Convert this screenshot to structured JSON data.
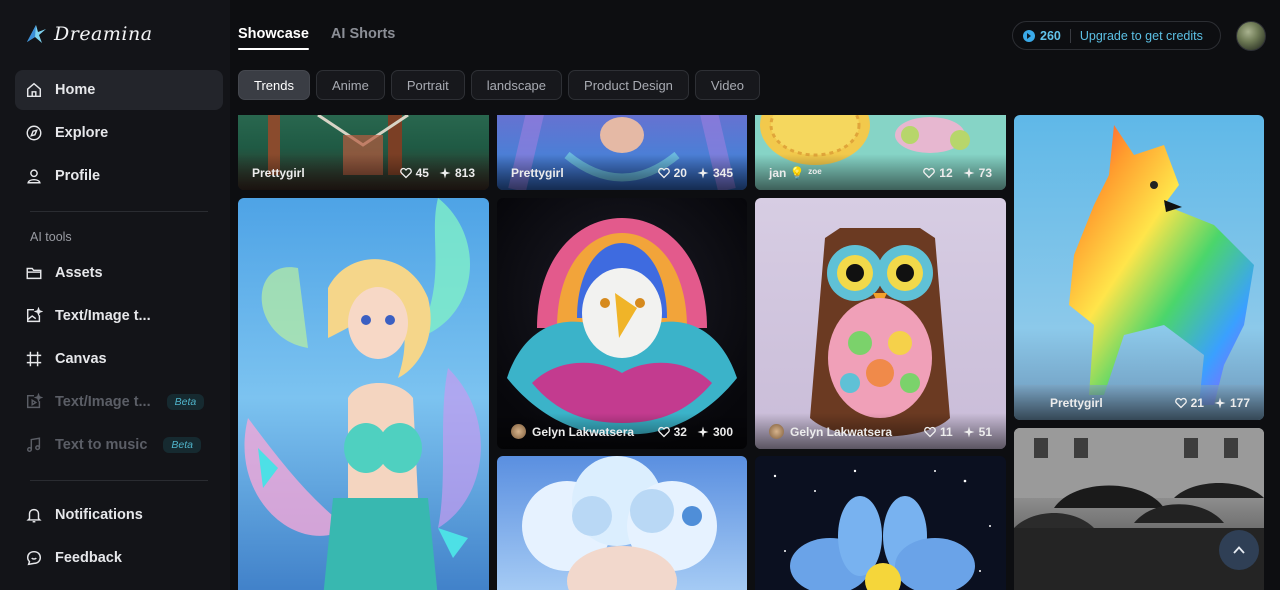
{
  "app": {
    "name": "Dreamina"
  },
  "sidebar": {
    "main_items": [
      {
        "label": "Home",
        "icon": "home-icon"
      },
      {
        "label": "Explore",
        "icon": "compass-icon"
      },
      {
        "label": "Profile",
        "icon": "user-icon"
      }
    ],
    "section_label": "AI tools",
    "tool_items": [
      {
        "label": "Assets",
        "icon": "folder-icon"
      },
      {
        "label": "Text/Image t...",
        "icon": "image-sparkle-icon"
      },
      {
        "label": "Canvas",
        "icon": "canvas-icon"
      },
      {
        "label": "Text/Image t...",
        "icon": "video-icon",
        "badge": "Beta"
      },
      {
        "label": "Text to music",
        "icon": "music-icon",
        "badge": "Beta"
      }
    ],
    "bottom_items": [
      {
        "label": "Notifications",
        "icon": "bell-icon"
      },
      {
        "label": "Feedback",
        "icon": "feedback-icon"
      }
    ]
  },
  "header": {
    "tabs": [
      {
        "label": "Showcase"
      },
      {
        "label": "AI Shorts"
      }
    ],
    "credits": {
      "amount": "260",
      "upgrade_label": "Upgrade to get credits"
    }
  },
  "filters": [
    {
      "label": "Trends"
    },
    {
      "label": "Anime"
    },
    {
      "label": "Portrait"
    },
    {
      "label": "landscape"
    },
    {
      "label": "Product Design"
    },
    {
      "label": "Video"
    }
  ],
  "cards": [
    {
      "author": "Prettygirl",
      "likes": "45",
      "uses": "813"
    },
    {
      "author": "Prettygirl",
      "likes": "20",
      "uses": "345"
    },
    {
      "author": "jan 💡 ᶻᵒᵉ",
      "likes": "12",
      "uses": "73"
    },
    {
      "author": "Prettygirl",
      "likes": "21",
      "uses": "177"
    },
    {
      "author": "Gelyn Lakwatsera",
      "likes": "32",
      "uses": "300"
    },
    {
      "author": "Gelyn Lakwatsera",
      "likes": "11",
      "uses": "51"
    }
  ],
  "colors": {
    "accent": "#5cc0e4",
    "background": "#0d0e11",
    "sidebar": "#131418"
  }
}
